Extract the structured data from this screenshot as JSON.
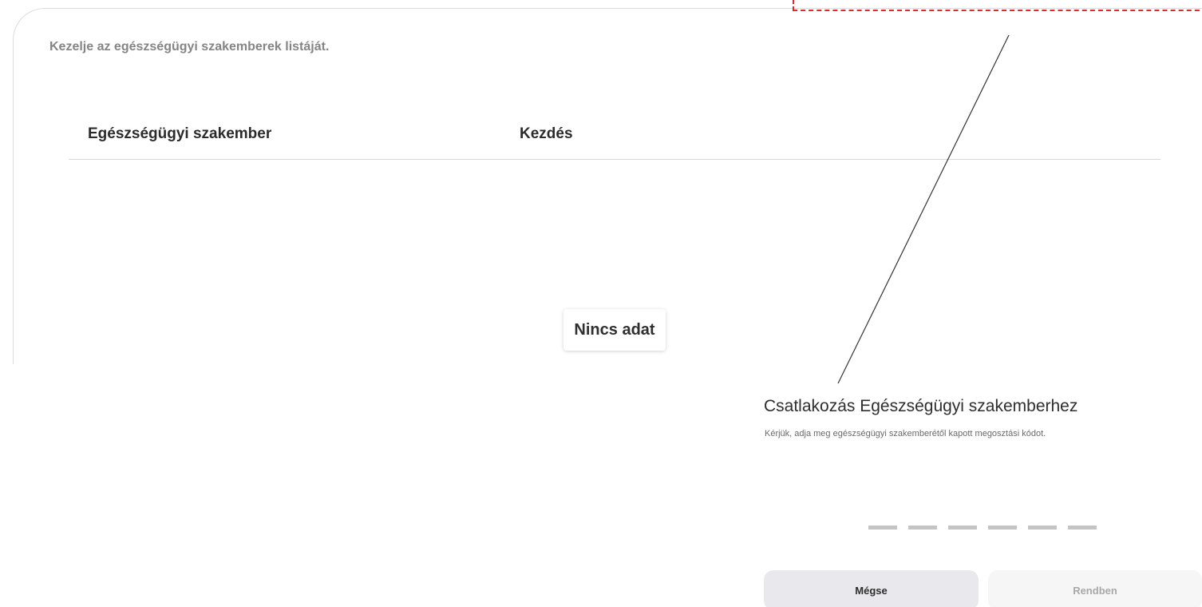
{
  "professionals": {
    "subtitle": "Kezelje az egészségügyi szakemberek listáját.",
    "table": {
      "columns": [
        "Egészségügyi szakember",
        "Kezdés"
      ],
      "rows": [],
      "empty_text": "Nincs adat"
    }
  },
  "dialog": {
    "title": "Csatlakozás Egészségügyi szakemberhez",
    "description": "Kérjük, adja meg egészségügyi szakemberétől kapott megosztási kódot.",
    "code_length": 6,
    "cancel_label": "Mégse",
    "ok_label": "Rendben"
  },
  "colors": {
    "annotation": "#d62c2c",
    "cancel_button_bg": "#e9e9ed",
    "ok_button_bg": "#f6f6f7"
  }
}
